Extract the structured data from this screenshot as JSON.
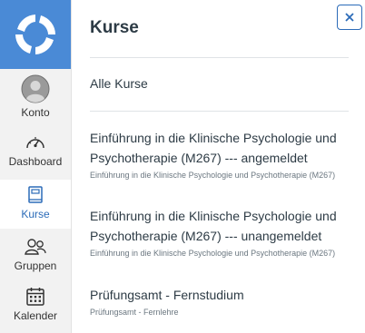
{
  "nav": {
    "items": [
      {
        "label": "Konto",
        "icon": "avatar-icon"
      },
      {
        "label": "Dashboard",
        "icon": "dashboard-gauge-icon"
      },
      {
        "label": "Kurse",
        "icon": "book-icon",
        "active": true
      },
      {
        "label": "Gruppen",
        "icon": "groups-icon"
      },
      {
        "label": "Kalender",
        "icon": "calendar-icon"
      }
    ]
  },
  "tray": {
    "title": "Kurse",
    "all_courses": "Alle Kurse",
    "courses": [
      {
        "name": "Einführung in die Klinische Psychologie und Psychotherapie (M267) --- angemeldet",
        "term": "Einführung in die Klinische Psychologie und Psychotherapie (M267)"
      },
      {
        "name": "Einführung in die Klinische Psychologie und Psychotherapie (M267) --- unangemeldet",
        "term": "Einführung in die Klinische Psychologie und Psychotherapie (M267)"
      },
      {
        "name": "Prüfungsamt - Fernstudium",
        "term": "Prüfungsamt - Fernlehre"
      }
    ]
  },
  "colors": {
    "brand": "#4a8ad6",
    "link_active": "#2b6bb8",
    "text": "#2d3b45"
  }
}
